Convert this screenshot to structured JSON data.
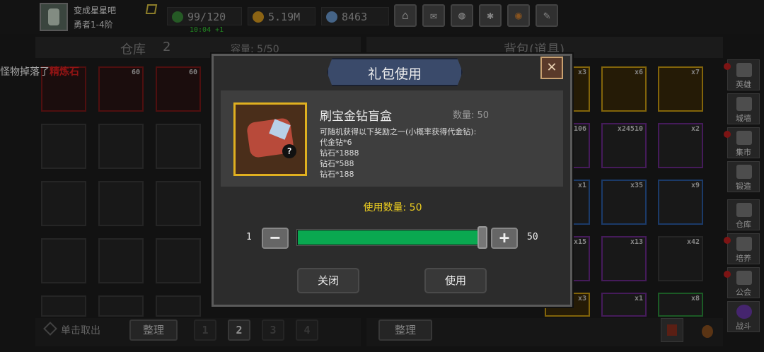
{
  "player": {
    "name": "变成星星吧",
    "rank": "勇者1-4阶"
  },
  "stats": {
    "energy": "99/120",
    "gold": "5.19M",
    "gems": "8463",
    "timer": "10:04 +1"
  },
  "toolbar": [
    "shop-icon",
    "mail-icon",
    "gamepad-icon",
    "gear-icon",
    "color-wheel-icon",
    "quill-icon"
  ],
  "warehouse": {
    "title": "仓库",
    "count": "2",
    "capacity": "容量: 5/50",
    "take_out": "单击取出",
    "sort": "整理",
    "pages": [
      "1",
      "2",
      "3",
      "4"
    ],
    "slot_counts": [
      "60",
      "60"
    ]
  },
  "backpack": {
    "title": "背包(道具)",
    "sort": "整理",
    "slot_counts": [
      "x3",
      "x6",
      "x7",
      "106",
      "x24510",
      "x2",
      "x1",
      "x35",
      "x9",
      "x15",
      "x13",
      "x42",
      "x3",
      "x1",
      "x8"
    ]
  },
  "side_menu": [
    "英雄",
    "城墙",
    "集市",
    "锻造",
    "仓库",
    "培养",
    "公会",
    "战斗"
  ],
  "marquee": {
    "prefix": "怪物掉落了",
    "item": "精炼石"
  },
  "dialog": {
    "title": "礼包使用",
    "item_name": "刷宝金钻盲盒",
    "qty_label": "数量: ",
    "qty_value": "50",
    "desc": [
      "可随机获得以下奖励之一(小概率获得代金钻):",
      "代金钻*6",
      "钻石*1888",
      "钻石*588",
      "钻石*188"
    ],
    "use_label": "使用数量: ",
    "use_value": "50",
    "min": "1",
    "max": "50",
    "slider_fraction": 1.0,
    "close_btn": "关闭",
    "use_btn": "使用"
  }
}
